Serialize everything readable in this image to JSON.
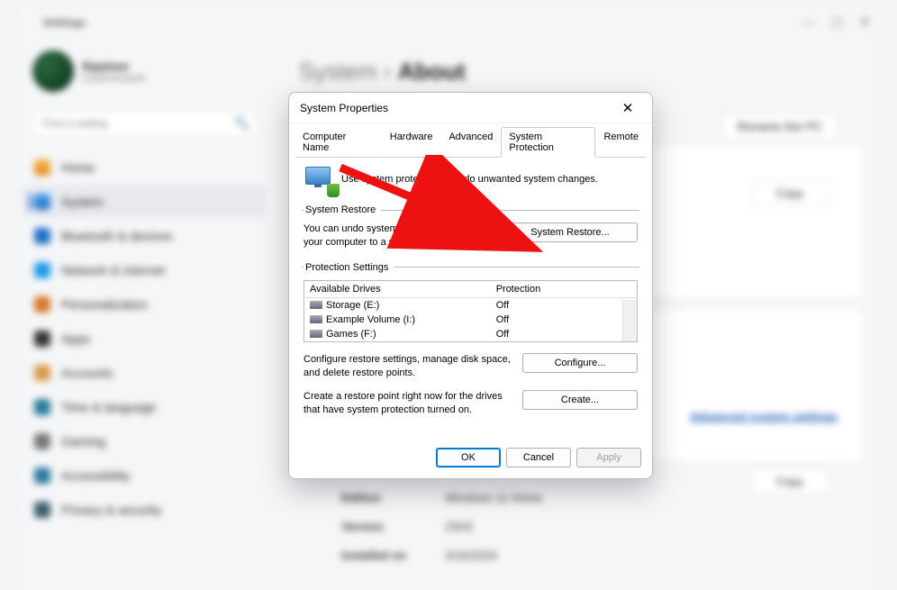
{
  "bg": {
    "window_title": "Settings",
    "profile": {
      "name": "Equinox",
      "sub": "Local Account"
    },
    "search_placeholder": "Find a setting",
    "nav": [
      {
        "label": "Home",
        "ico": "ico-home"
      },
      {
        "label": "System",
        "ico": "ico-system",
        "active": true
      },
      {
        "label": "Bluetooth & devices",
        "ico": "ico-bt"
      },
      {
        "label": "Network & internet",
        "ico": "ico-net"
      },
      {
        "label": "Personalization",
        "ico": "ico-pers"
      },
      {
        "label": "Apps",
        "ico": "ico-apps"
      },
      {
        "label": "Accounts",
        "ico": "ico-acc"
      },
      {
        "label": "Time & language",
        "ico": "ico-time"
      },
      {
        "label": "Gaming",
        "ico": "ico-game"
      },
      {
        "label": "Accessibility",
        "ico": "ico-access"
      },
      {
        "label": "Privacy & security",
        "ico": "ico-priv"
      }
    ],
    "crumb_root": "System",
    "crumb_sep": "›",
    "crumb_current": "About",
    "rename_btn": "Rename this PC",
    "copy_btn": "Copy",
    "adv_link": "Advanced system settings",
    "specs": [
      {
        "k": "Edition",
        "v": "Windows 11 Home"
      },
      {
        "k": "Version",
        "v": "23H2"
      },
      {
        "k": "Installed on",
        "v": "3/16/2024"
      }
    ]
  },
  "dialog": {
    "title": "System Properties",
    "tabs": [
      "Computer Name",
      "Hardware",
      "Advanced",
      "System Protection",
      "Remote"
    ],
    "active_tab_index": 3,
    "intro_text": "Use system protection to undo unwanted system changes.",
    "restore": {
      "legend": "System Restore",
      "text": "You can undo system changes by reverting your computer to a previous restore point.",
      "button": "System Restore..."
    },
    "protection": {
      "legend": "Protection Settings",
      "col_drives": "Available Drives",
      "col_protection": "Protection",
      "drives": [
        {
          "name": "Storage (E:)",
          "status": "Off"
        },
        {
          "name": "Example Volume (I:)",
          "status": "Off"
        },
        {
          "name": "Games (F:)",
          "status": "Off"
        }
      ],
      "configure_text": "Configure restore settings, manage disk space, and delete restore points.",
      "configure_btn": "Configure...",
      "create_text": "Create a restore point right now for the drives that have system protection turned on.",
      "create_btn": "Create..."
    },
    "footer": {
      "ok": "OK",
      "cancel": "Cancel",
      "apply": "Apply"
    }
  }
}
